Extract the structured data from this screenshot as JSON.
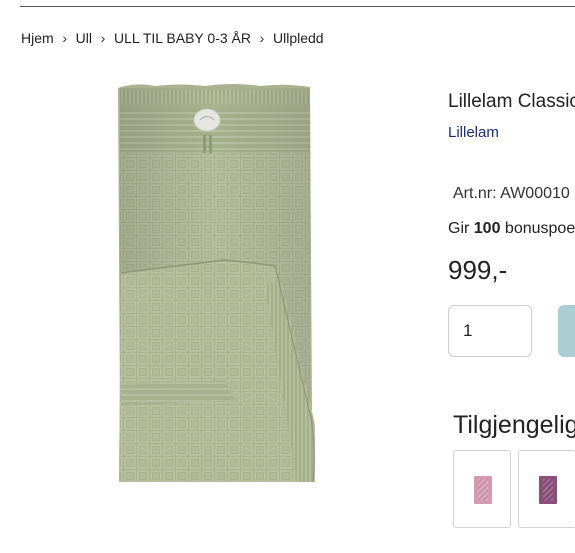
{
  "breadcrumb": {
    "items": [
      "Hjem",
      "Ull",
      "ULL TIL BABY 0-3 ÅR",
      "Ullpledd"
    ],
    "separator": "›"
  },
  "product": {
    "title": "Lillelam Classic",
    "brand": "Lillelam",
    "art_nr": "Art.nr: AW00010",
    "bonus_prefix": "Gir ",
    "bonus_points": "100",
    "bonus_suffix": " bonuspoeng",
    "price": "999,-",
    "blanket_color": "#a9b390"
  },
  "purchase": {
    "quantity": "1",
    "button_color": "#a9cfd3"
  },
  "availability": {
    "heading": "Tilgjengelig i",
    "variants": [
      {
        "name": "pink",
        "color": "#d59ab0"
      },
      {
        "name": "plum",
        "color": "#8a4f7a"
      }
    ]
  }
}
